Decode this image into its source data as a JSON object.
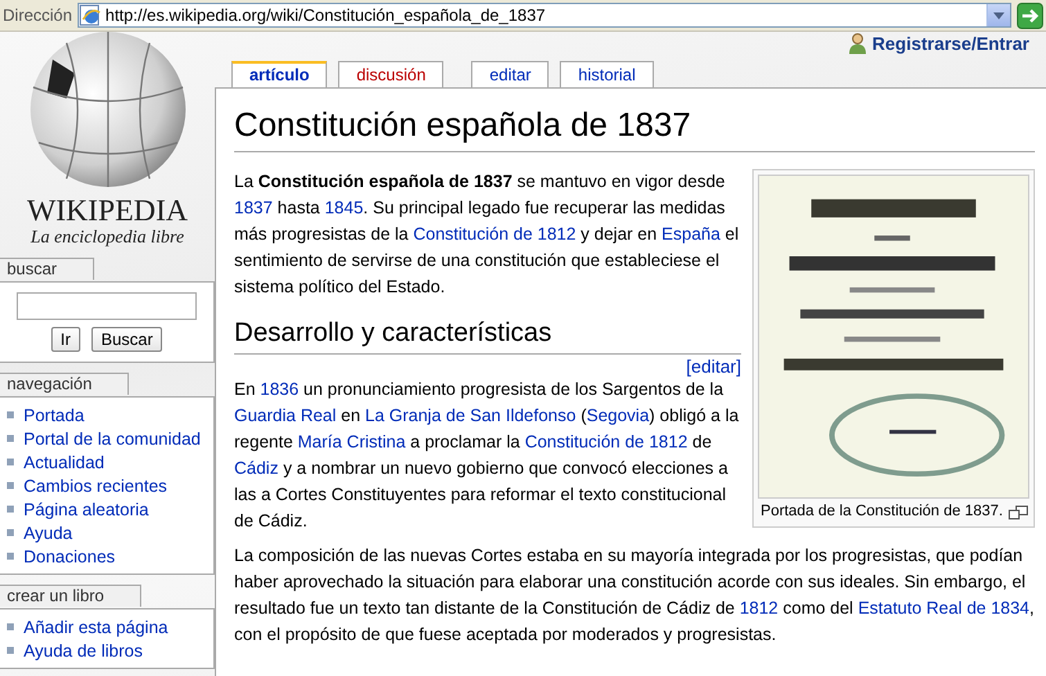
{
  "address_bar": {
    "label": "Dirección",
    "url": "http://es.wikipedia.org/wiki/Constitución_española_de_1837"
  },
  "user_link": "Registrarse/Entrar",
  "logo": {
    "wordmark": "WIKIPEDIA",
    "tagline": "La enciclopedia libre"
  },
  "tab_groups": [
    {
      "tabs": [
        {
          "label": "artículo",
          "selected": true,
          "missing": false
        },
        {
          "label": "discusión",
          "selected": false,
          "missing": true
        }
      ]
    },
    {
      "tabs": [
        {
          "label": "editar",
          "selected": false,
          "missing": false
        },
        {
          "label": "historial",
          "selected": false,
          "missing": false
        }
      ]
    }
  ],
  "portlets": [
    {
      "title": "buscar",
      "kind": "search",
      "buttons": [
        "Ir",
        "Buscar"
      ]
    },
    {
      "title": "navegación",
      "kind": "links",
      "items": [
        "Portada",
        "Portal de la comunidad",
        "Actualidad",
        "Cambios recientes",
        "Página aleatoria",
        "Ayuda",
        "Donaciones"
      ]
    },
    {
      "title": "crear un libro",
      "kind": "links",
      "items": [
        "Añadir esta página",
        "Ayuda de libros"
      ]
    }
  ],
  "article": {
    "title": "Constitución española de 1837",
    "thumb": {
      "kind": "picture",
      "caption": "Portada de la Constitución de 1837."
    },
    "blocks": [
      {
        "kind": "paragraph",
        "parts": [
          {
            "kind": "text",
            "text": "La "
          },
          {
            "kind": "bold",
            "text": "Constitución española de 1837"
          },
          {
            "kind": "text",
            "text": " se mantuvo en vigor desde "
          },
          {
            "kind": "link",
            "text": "1837"
          },
          {
            "kind": "text",
            "text": " hasta "
          },
          {
            "kind": "link",
            "text": "1845"
          },
          {
            "kind": "text",
            "text": ". Su principal legado fue recuperar las medidas más progresistas de la "
          },
          {
            "kind": "link",
            "text": "Constitución de 1812"
          },
          {
            "kind": "text",
            "text": " y dejar en "
          },
          {
            "kind": "link",
            "text": "España"
          },
          {
            "kind": "text",
            "text": " el sentimiento de servirse de una constitución que estableciese el sistema político del Estado."
          }
        ]
      },
      {
        "kind": "heading",
        "text": "Desarrollo y características",
        "edit": "[editar]"
      },
      {
        "kind": "paragraph",
        "parts": [
          {
            "kind": "text",
            "text": "En "
          },
          {
            "kind": "link",
            "text": "1836"
          },
          {
            "kind": "text",
            "text": " un pronunciamiento progresista de los Sargentos de la "
          },
          {
            "kind": "link",
            "text": "Guardia Real"
          },
          {
            "kind": "text",
            "text": " en "
          },
          {
            "kind": "link",
            "text": "La Granja de San Ildefonso"
          },
          {
            "kind": "text",
            "text": " ("
          },
          {
            "kind": "link",
            "text": "Segovia"
          },
          {
            "kind": "text",
            "text": ") obligó a la regente "
          },
          {
            "kind": "link",
            "text": "María Cristina"
          },
          {
            "kind": "text",
            "text": " a proclamar la "
          },
          {
            "kind": "link",
            "text": "Constitución de 1812"
          },
          {
            "kind": "text",
            "text": " de "
          },
          {
            "kind": "link",
            "text": "Cádiz"
          },
          {
            "kind": "text",
            "text": " y a nombrar un nuevo gobierno que convocó elecciones a las a Cortes Constituyentes para reformar el texto constitucional de Cádiz."
          }
        ]
      },
      {
        "kind": "paragraph",
        "parts": [
          {
            "kind": "text",
            "text": "La composición de las nuevas Cortes estaba en su mayoría integrada por los progresistas, que podían haber aprovechado la situación para elaborar una constitución acorde con sus ideales. Sin embargo, el resultado fue un texto tan distante de la Constitución de Cádiz de "
          },
          {
            "kind": "link",
            "text": "1812"
          },
          {
            "kind": "text",
            "text": " como del "
          },
          {
            "kind": "link",
            "text": "Estatuto Real de 1834"
          },
          {
            "kind": "text",
            "text": ", con el propósito de que fuese aceptada por moderados y progresistas."
          }
        ]
      }
    ]
  }
}
